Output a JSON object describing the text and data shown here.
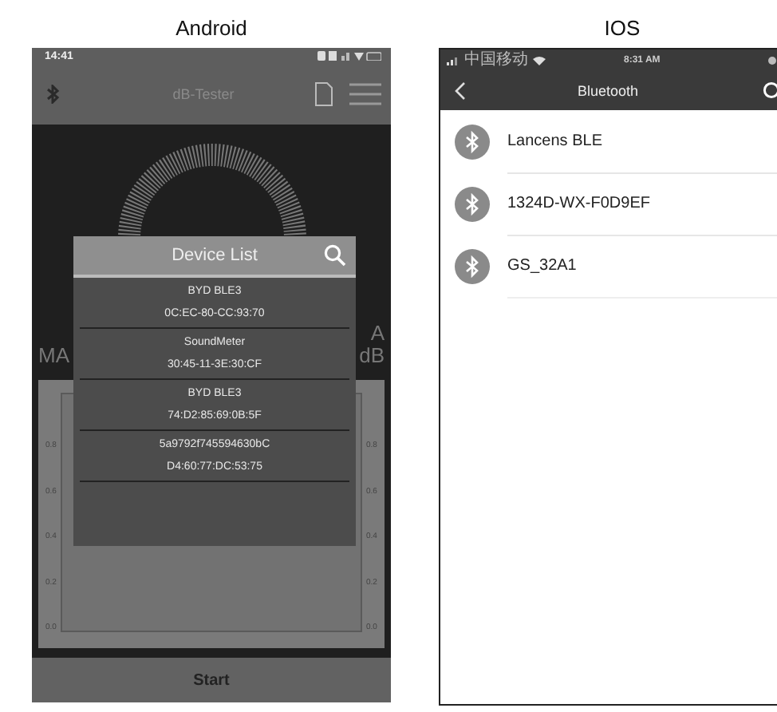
{
  "captions": [
    "Android",
    "IOS"
  ],
  "android": {
    "status_time": "14:41",
    "title": "dB-Tester",
    "left_label": "MA",
    "right_labels": [
      "A",
      "dB"
    ],
    "left_axis": [
      "0.8",
      "0.6",
      "0.4",
      "0.2",
      "0.0"
    ],
    "right_axis": [
      "0.8",
      "0.6",
      "0.4",
      "0.2",
      "0.0"
    ],
    "dialog": {
      "title": "Device List",
      "devices": [
        {
          "name": "BYD BLE3",
          "address": "0C:EC-80-CC:93:70"
        },
        {
          "name": "SoundMeter",
          "address": "30:45-11-3E:30:CF"
        },
        {
          "name": "BYD BLE3",
          "address": "74:D2:85:69:0B:5F"
        },
        {
          "name": "5a9792f745594630bC",
          "address": "D4:60:77:DC:53:75"
        }
      ]
    },
    "start_button": "Start"
  },
  "ios": {
    "carrier": "中国移动",
    "time": "8:31 AM",
    "title": "Bluetooth",
    "devices": [
      "Lancens BLE",
      "1324D-WX-F0D9EF",
      "GS_32A1"
    ]
  }
}
